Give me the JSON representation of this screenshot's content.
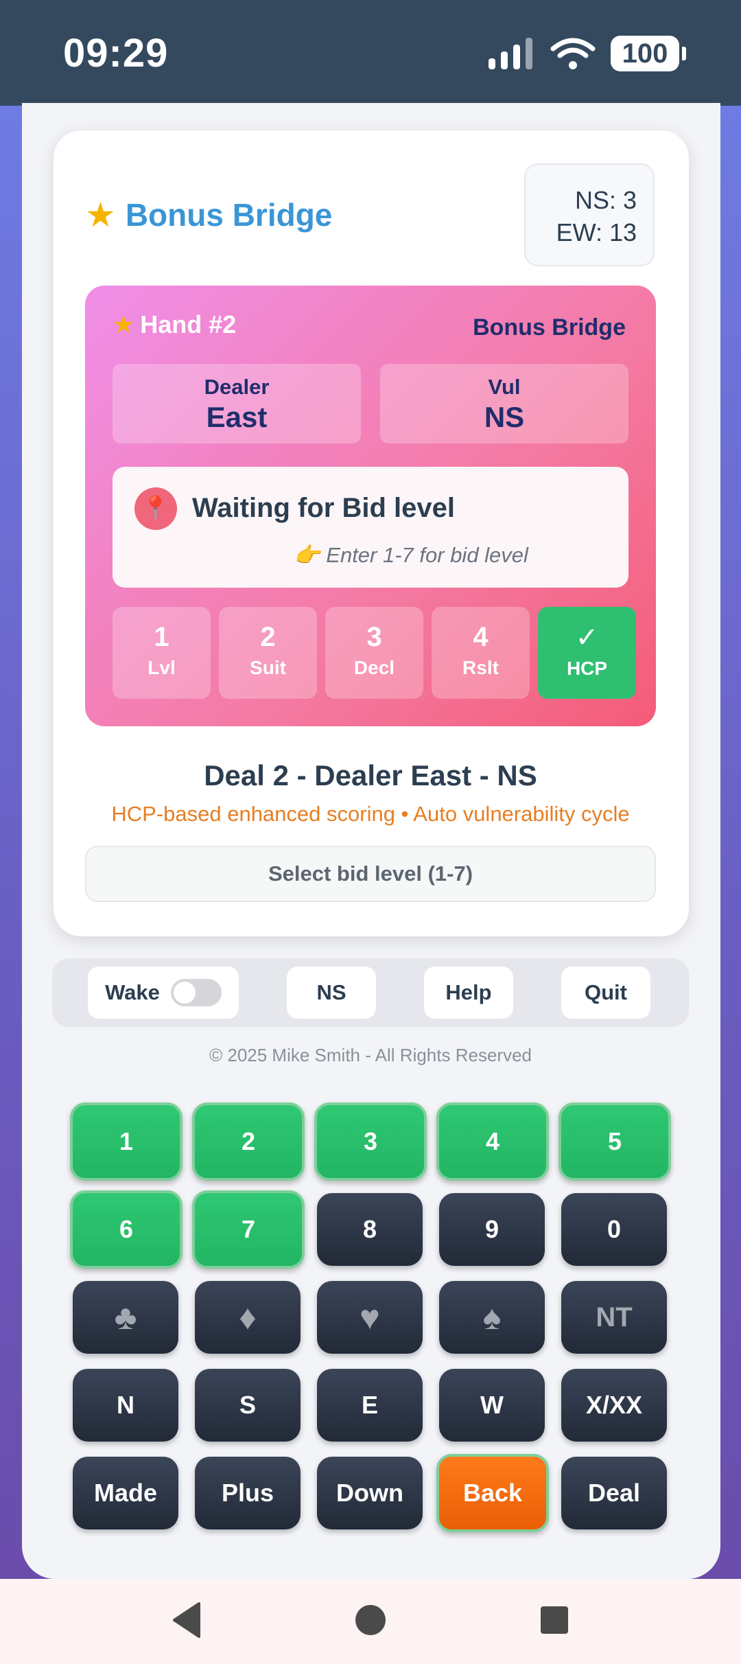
{
  "status_bar": {
    "time": "09:29",
    "battery": "100"
  },
  "app": {
    "title": "Bonus Bridge",
    "score": {
      "ns": "NS: 3",
      "ew": "EW: 13"
    }
  },
  "hand": {
    "title": "Hand #2",
    "brand": "Bonus Bridge",
    "dealer": {
      "label": "Dealer",
      "value": "East"
    },
    "vul": {
      "label": "Vul",
      "value": "NS"
    },
    "status": {
      "heading": "Waiting for Bid level",
      "hint": "👉 Enter 1-7 for bid level"
    },
    "steps": [
      {
        "num": "1",
        "abbr": "Lvl"
      },
      {
        "num": "2",
        "abbr": "Suit"
      },
      {
        "num": "3",
        "abbr": "Decl"
      },
      {
        "num": "4",
        "abbr": "Rslt"
      },
      {
        "num": "✓",
        "abbr": "HCP"
      }
    ]
  },
  "deal_summary": "Deal 2 - Dealer East - NS",
  "scoring_note": "HCP-based enhanced scoring • Auto vulnerability cycle",
  "prompt": "Select bid level (1-7)",
  "controls": {
    "wake": "Wake",
    "ns": "NS",
    "help": "Help",
    "quit": "Quit",
    "wake_on": false
  },
  "copyright": "© 2025 Mike Smith - All Rights Reserved",
  "keypad": {
    "rows": [
      [
        "1",
        "2",
        "3",
        "4",
        "5"
      ],
      [
        "6",
        "7",
        "8",
        "9",
        "0"
      ],
      [
        "♣",
        "♦",
        "♥",
        "♠",
        "NT"
      ],
      [
        "N",
        "S",
        "E",
        "W",
        "X/XX"
      ],
      [
        "Made",
        "Plus",
        "Down",
        "Back",
        "Deal"
      ]
    ]
  },
  "colors": {
    "accent": "#3a96d6",
    "active_key": "#2fc873",
    "back_key": "#ff7a1a",
    "scoring_note": "#e67e22"
  }
}
